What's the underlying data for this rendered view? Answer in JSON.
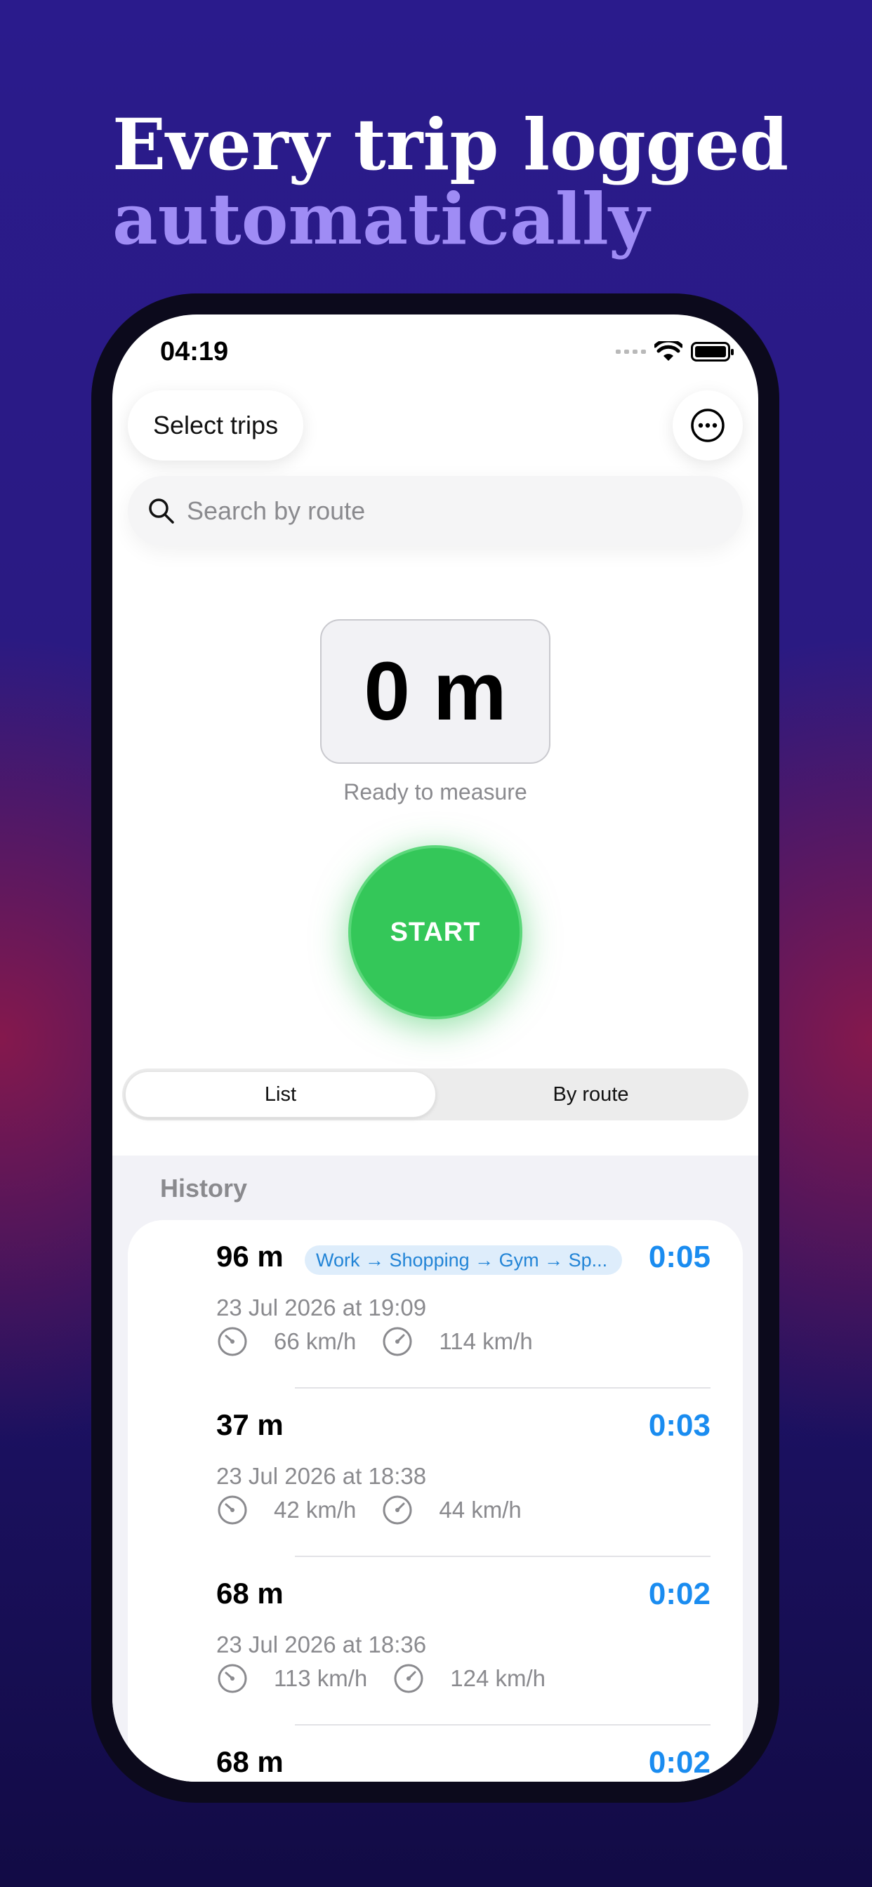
{
  "headline": {
    "line1": "Every trip logged",
    "line2": "automatically"
  },
  "status_bar": {
    "time": "04:19"
  },
  "toolbar": {
    "select_label": "Select trips",
    "more_icon": "ellipsis-circle-icon"
  },
  "search": {
    "placeholder": "Search by route",
    "icon": "search-icon"
  },
  "measure": {
    "distance": "0 m",
    "status": "Ready to measure",
    "start_label": "START"
  },
  "segments": {
    "list": "List",
    "by_route": "By route",
    "selected": "List"
  },
  "history": {
    "title": "History",
    "trips": [
      {
        "distance": "96 m",
        "route": "Work → Shopping → Gym → Sp...",
        "duration": "0:05",
        "date": "23 Jul 2026 at 19:09",
        "avg_speed": "66 km/h",
        "max_speed": "114 km/h"
      },
      {
        "distance": "37 m",
        "duration": "0:03",
        "date": "23 Jul 2026 at 18:38",
        "avg_speed": "42 km/h",
        "max_speed": "44 km/h"
      },
      {
        "distance": "68 m",
        "duration": "0:02",
        "date": "23 Jul 2026 at 18:36",
        "avg_speed": "113 km/h",
        "max_speed": "124 km/h"
      },
      {
        "distance": "68 m",
        "duration": "0:02"
      }
    ]
  },
  "colors": {
    "accent_blue": "#1a8cf0",
    "start_green": "#34c759",
    "headline_purple": "#9f8cf5"
  }
}
